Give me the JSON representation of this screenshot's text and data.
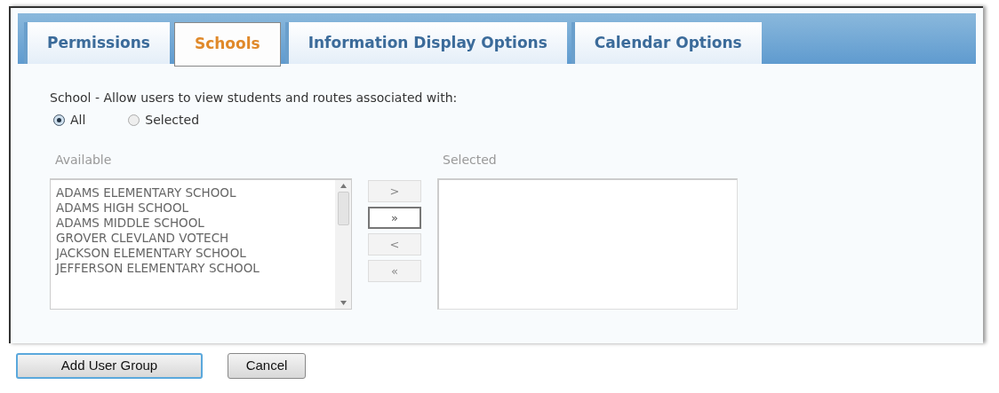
{
  "tabs": [
    {
      "label": "Permissions",
      "selected": false
    },
    {
      "label": "Schools",
      "selected": true
    },
    {
      "label": "Information Display Options",
      "selected": false
    },
    {
      "label": "Calendar Options",
      "selected": false
    }
  ],
  "prompt": "School - Allow users to view students and routes associated with:",
  "scope_options": [
    {
      "label": "All",
      "selected": true
    },
    {
      "label": "Selected",
      "selected": false
    }
  ],
  "available": {
    "label": "Available",
    "items": [
      "ADAMS ELEMENTARY SCHOOL",
      "ADAMS HIGH SCHOOL",
      "ADAMS MIDDLE SCHOOL",
      "GROVER CLEVLAND VOTECH",
      "JACKSON ELEMENTARY SCHOOL",
      "JEFFERSON ELEMENTARY SCHOOL"
    ]
  },
  "transfer_buttons": [
    {
      "label": ">",
      "disabled": true
    },
    {
      "label": "»",
      "disabled": false
    },
    {
      "label": "<",
      "disabled": true
    },
    {
      "label": "«",
      "disabled": true
    }
  ],
  "selected_list": {
    "label": "Selected"
  },
  "buttons": [
    {
      "label": "Add User Group",
      "kind": "primary"
    },
    {
      "label": "Cancel",
      "kind": "secondary"
    }
  ]
}
